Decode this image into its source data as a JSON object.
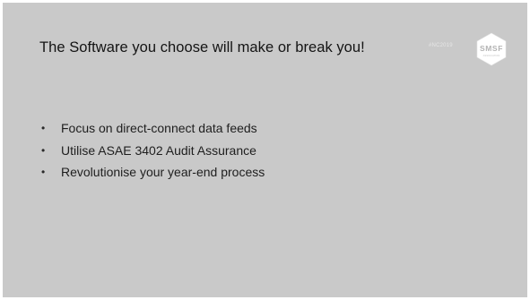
{
  "slide": {
    "title": "The Software you choose will make or break you!",
    "hashtag": "#NC2019",
    "logo": {
      "text": "SMSF",
      "subtext": "ASSOCIATION",
      "icon": "smsf-association-hexagon-logo"
    },
    "bullet_symbol": "•",
    "bullets": [
      "Focus on direct-connect data feeds",
      "Utilise ASAE 3402 Audit Assurance",
      "Revolutionise your year-end process"
    ]
  },
  "colors": {
    "slide_background": "#c9c9c9",
    "page_background": "#ffffff",
    "text": "#1e1e1e",
    "logo_fill": "#ffffff",
    "logo_text": "#b4b4b4"
  }
}
